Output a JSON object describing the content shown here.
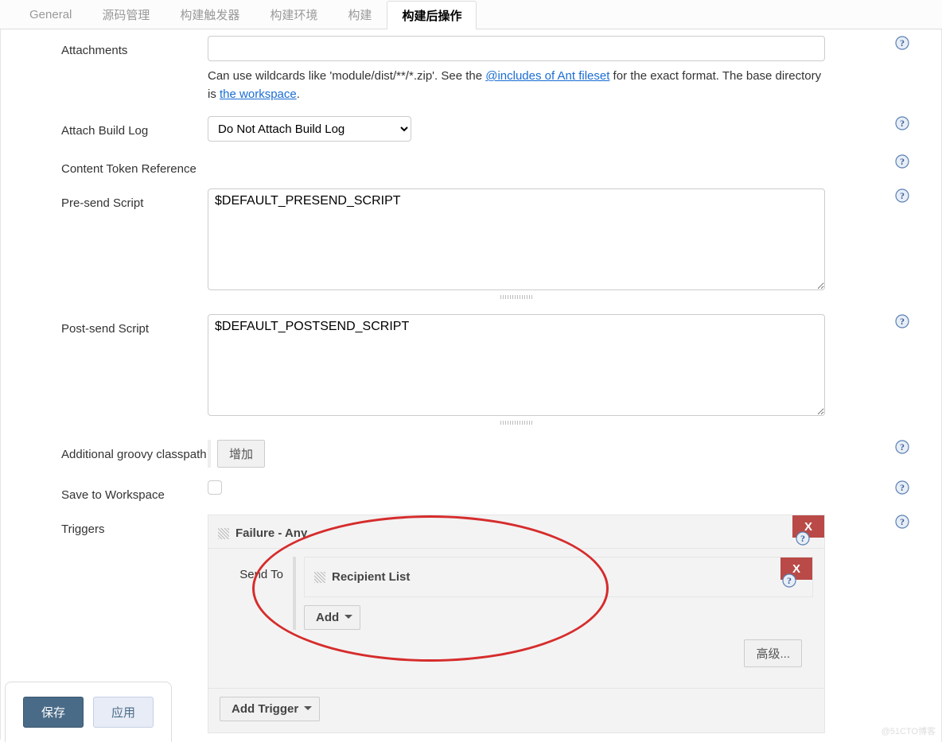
{
  "tabs": {
    "general": "General",
    "scm": "源码管理",
    "triggers": "构建触发器",
    "env": "构建环境",
    "build": "构建",
    "post": "构建后操作"
  },
  "attachments": {
    "label": "Attachments",
    "value": "",
    "help_pre": "Can use wildcards like 'module/dist/**/*.zip'. See the ",
    "help_link1": "@includes of Ant fileset",
    "help_mid": " for the exact format. The base directory is ",
    "help_link2": "the workspace",
    "help_end": "."
  },
  "attach_build_log": {
    "label": "Attach Build Log",
    "selected": "Do Not Attach Build Log",
    "options": [
      "Do Not Attach Build Log"
    ]
  },
  "content_token": {
    "label": "Content Token Reference"
  },
  "presend": {
    "label": "Pre-send Script",
    "value": "$DEFAULT_PRESEND_SCRIPT"
  },
  "postsend": {
    "label": "Post-send Script",
    "value": "$DEFAULT_POSTSEND_SCRIPT"
  },
  "classpath": {
    "label": "Additional groovy classpath",
    "add_btn": "增加"
  },
  "save_workspace": {
    "label": "Save to Workspace"
  },
  "triggers_section": {
    "label": "Triggers",
    "trigger_name": "Failure - Any",
    "send_to_label": "Send To",
    "recipient_label": "Recipient List",
    "add_btn": "Add",
    "advanced_btn": "高级...",
    "add_trigger_btn": "Add Trigger",
    "delete_x": "X"
  },
  "footer": {
    "save": "保存",
    "apply": "应用"
  },
  "watermark": "@51CTO博客"
}
